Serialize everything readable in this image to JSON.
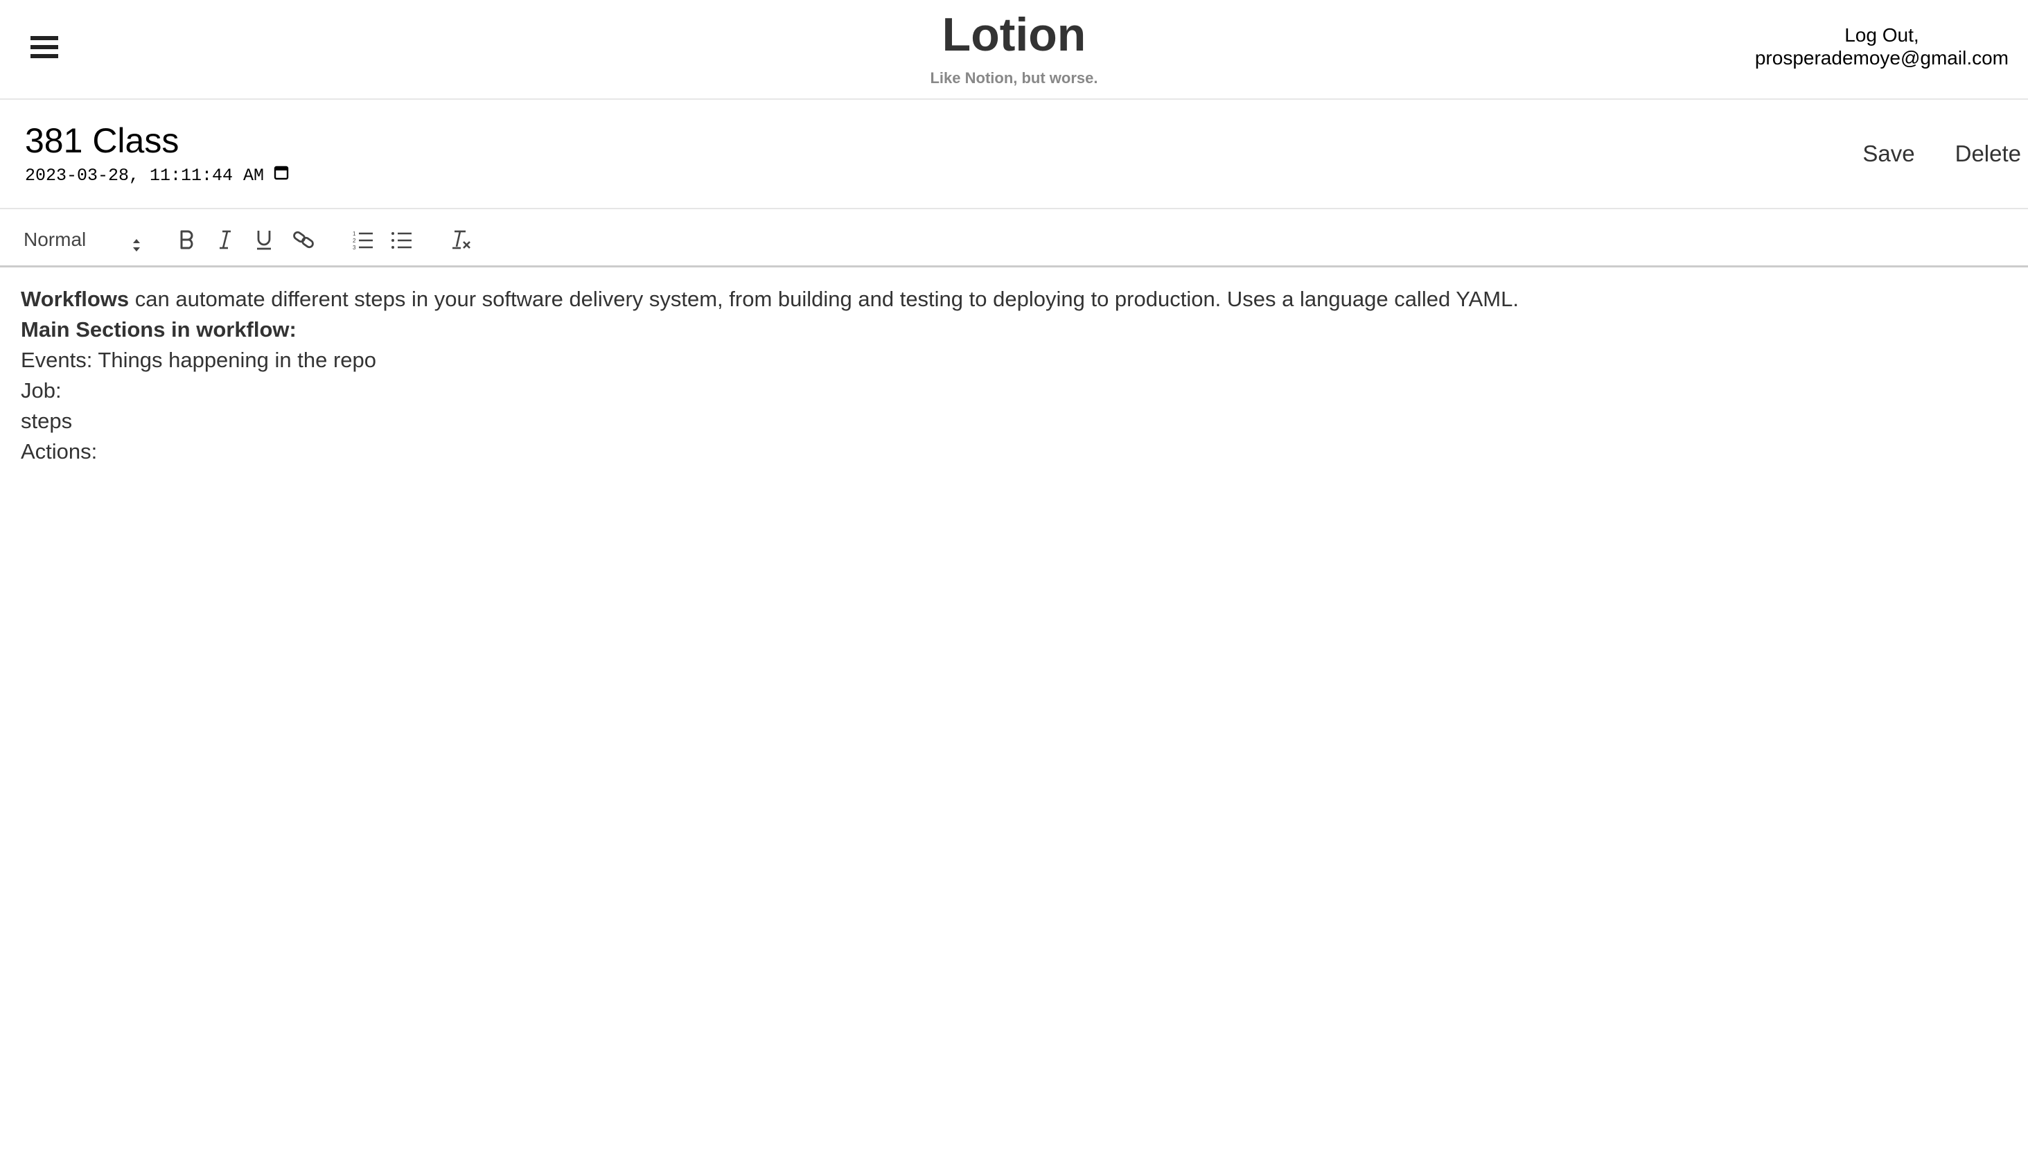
{
  "header": {
    "menu_icon": "hamburger-menu-icon",
    "brand_title": "Lotion",
    "brand_subtitle": "Like Notion, but worse.",
    "logout_label": "Log Out,",
    "user_email": "prosperademoye@gmail.com"
  },
  "note": {
    "title": "381 Class",
    "datetime": "2023-03-28, 11:11:44 AM",
    "calendar_icon": "calendar-icon",
    "save_label": "Save",
    "delete_label": "Delete"
  },
  "toolbar": {
    "format_selected": "Normal",
    "buttons": [
      "bold-icon",
      "italic-icon",
      "underline-icon",
      "link-icon",
      "ordered-list-icon",
      "bullet-list-icon",
      "clear-format-icon"
    ]
  },
  "content": {
    "line1_bold": "Workflows",
    "line1_rest": " can automate different steps in your software delivery system, from building and testing to deploying to production. Uses a language called YAML.",
    "line2_bold": "Main Sections in workflow:",
    "line3": "Events: Things happening in the repo",
    "line4": "Job:",
    "line5": "steps",
    "line6": "Actions:"
  },
  "colors": {
    "text": "#333333",
    "subtitle": "#888888",
    "divider": "#e6e6e6"
  }
}
